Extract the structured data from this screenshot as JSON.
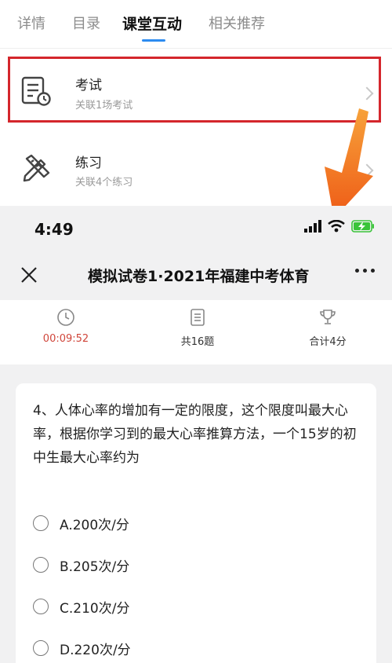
{
  "tabs": {
    "items": [
      {
        "label": "详情"
      },
      {
        "label": "目录"
      },
      {
        "label": "课堂互动"
      },
      {
        "label": "相关推荐"
      }
    ],
    "active_index": 2
  },
  "course_items": [
    {
      "title": "考试",
      "subtitle": "关联1场考试",
      "icon": "exam-document-clock-icon"
    },
    {
      "title": "练习",
      "subtitle": "关联4个练习",
      "icon": "pencil-ruler-icon"
    }
  ],
  "colors": {
    "highlight_border": "#d4262c",
    "tab_accent": "#2d8cf0",
    "arrow_orange": "#f26a1b",
    "timer_red": "#d0463b",
    "battery_green": "#3ac43a"
  },
  "phone": {
    "status": {
      "time": "4:49"
    },
    "nav": {
      "title": "模拟试卷1·2021年福建中考体育"
    },
    "info": {
      "timer": "00:09:52",
      "count": "共16题",
      "score": "合计4分"
    },
    "question": {
      "text": "4、人体心率的增加有一定的限度，这个限度叫最大心率，根据你学习到的最大心率推算方法，一个15岁的初中生最大心率约为",
      "options": [
        {
          "label": "A.200次/分"
        },
        {
          "label": "B.205次/分"
        },
        {
          "label": "C.210次/分"
        },
        {
          "label": "D.220次/分"
        }
      ]
    }
  }
}
